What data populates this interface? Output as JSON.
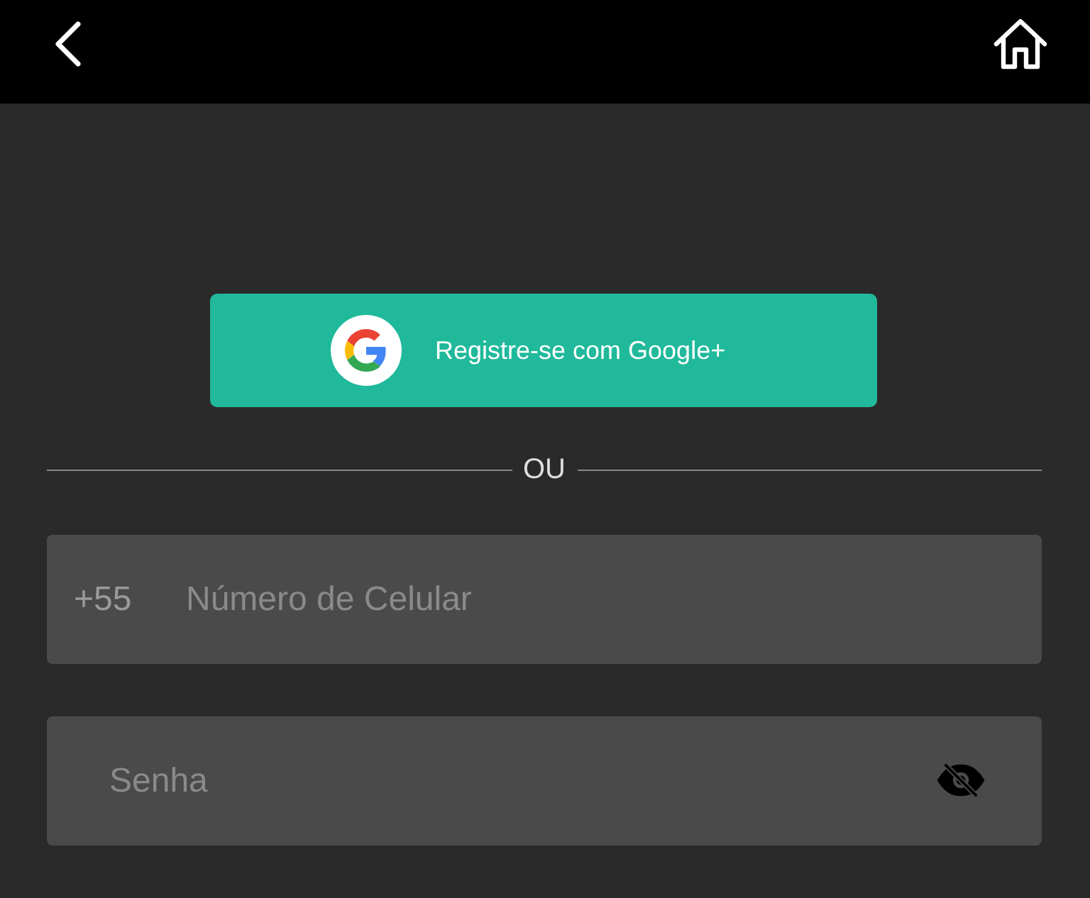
{
  "google_button": {
    "label": "Registre-se com Google+"
  },
  "divider": {
    "label": "OU"
  },
  "phone_field": {
    "prefix": "+55",
    "placeholder": "Número de Celular"
  },
  "password_field": {
    "placeholder": "Senha",
    "visible": false
  }
}
